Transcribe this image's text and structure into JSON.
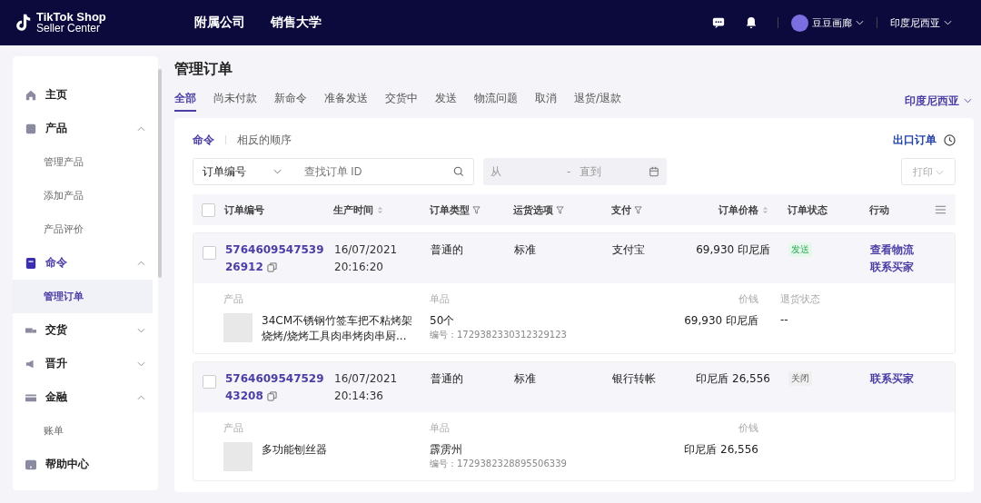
{
  "topbar": {
    "logo_line1": "TikTok Shop",
    "logo_line2": "Seller Center",
    "links": [
      "附属公司",
      "销售大学"
    ],
    "user": "豆豆画廊",
    "region": "印度尼西亚"
  },
  "sidebar": {
    "items": [
      {
        "label": "主页",
        "selected": false
      },
      {
        "label": "产品",
        "expanded": true,
        "selected": false,
        "children": [
          {
            "label": "管理产品",
            "selected": false
          },
          {
            "label": "添加产品",
            "selected": false
          },
          {
            "label": "产品评价",
            "selected": false
          }
        ]
      },
      {
        "label": "命令",
        "expanded": true,
        "selected": true,
        "children": [
          {
            "label": "管理订单",
            "selected": true
          }
        ]
      },
      {
        "label": "交货",
        "expanded": false,
        "selected": false
      },
      {
        "label": "晋升",
        "expanded": false,
        "selected": false
      },
      {
        "label": "金融",
        "expanded": true,
        "selected": false,
        "children": [
          {
            "label": "账单",
            "selected": false
          }
        ]
      },
      {
        "label": "帮助中心",
        "selected": false
      }
    ]
  },
  "page_title": "管理订单",
  "tabs": [
    {
      "label": "全部",
      "selected": true
    },
    {
      "label": "尚未付款",
      "selected": false
    },
    {
      "label": "新命令",
      "selected": false
    },
    {
      "label": "准备发送",
      "selected": false
    },
    {
      "label": "交货中",
      "selected": false
    },
    {
      "label": "发送",
      "selected": false
    },
    {
      "label": "物流问题",
      "selected": false
    },
    {
      "label": "取消",
      "selected": false
    },
    {
      "label": "退货/退款",
      "selected": false
    }
  ],
  "region_select": "印度尼西亚",
  "subtabs": [
    {
      "label": "命令",
      "selected": true
    },
    {
      "label": "相反的顺序",
      "selected": false
    }
  ],
  "export": "出口订单",
  "filter": {
    "field": "订单编号",
    "placeholder": "查找订单 ID",
    "date_from": "从",
    "date_separator": "-",
    "date_to": "直到",
    "print": "打印",
    "print_disabled": true
  },
  "columns": [
    {
      "label": "订单编号",
      "kind": "plain"
    },
    {
      "label": "生产时间",
      "kind": "sort"
    },
    {
      "label": "订单类型",
      "kind": "filter"
    },
    {
      "label": "运货选项",
      "kind": "filter"
    },
    {
      "label": "支付",
      "kind": "filter"
    },
    {
      "label": "订单价格",
      "kind": "sort"
    },
    {
      "label": "订单状态",
      "kind": "plain"
    },
    {
      "label": "行动",
      "kind": "plain"
    }
  ],
  "header_checked": false,
  "orders": [
    {
      "checked": false,
      "id_line1": "5764609547539",
      "id_line2": "26912",
      "date": "16/07/2021",
      "time": "20:16:20",
      "type": "普通的",
      "shipping": "标准",
      "payment": "支付宝",
      "price": "69,930 印尼盾",
      "status": {
        "label": "发送",
        "kind": "shipped"
      },
      "actions": [
        "查看物流",
        "联系买家"
      ],
      "labels": {
        "product": "产品",
        "unit": "单品",
        "price": "价钱",
        "return": "退货状态"
      },
      "product": {
        "name": "34CM不锈钢竹签车把不粘烤架烧烤/烧烤工具肉串烤肉串厨...",
        "qty": "50个",
        "sku": "编号：1729382330312329123",
        "price": "69,930 印尼盾",
        "return_status": "--"
      }
    },
    {
      "checked": false,
      "id_line1": "5764609547529",
      "id_line2": "43208",
      "date": "16/07/2021",
      "time": "20:14:36",
      "type": "普通的",
      "shipping": "标准",
      "payment": "银行转帐",
      "price": "印尼盾 26,556",
      "status": {
        "label": "关闭",
        "kind": "closed"
      },
      "actions": [
        "联系买家"
      ],
      "labels": {
        "product": "产品",
        "unit": "单品",
        "price": "价钱"
      },
      "product": {
        "name": "多功能刨丝器",
        "qty": "霹雳州",
        "sku": "编号：1729382328895506339",
        "price": "印尼盾 26,556"
      }
    }
  ]
}
